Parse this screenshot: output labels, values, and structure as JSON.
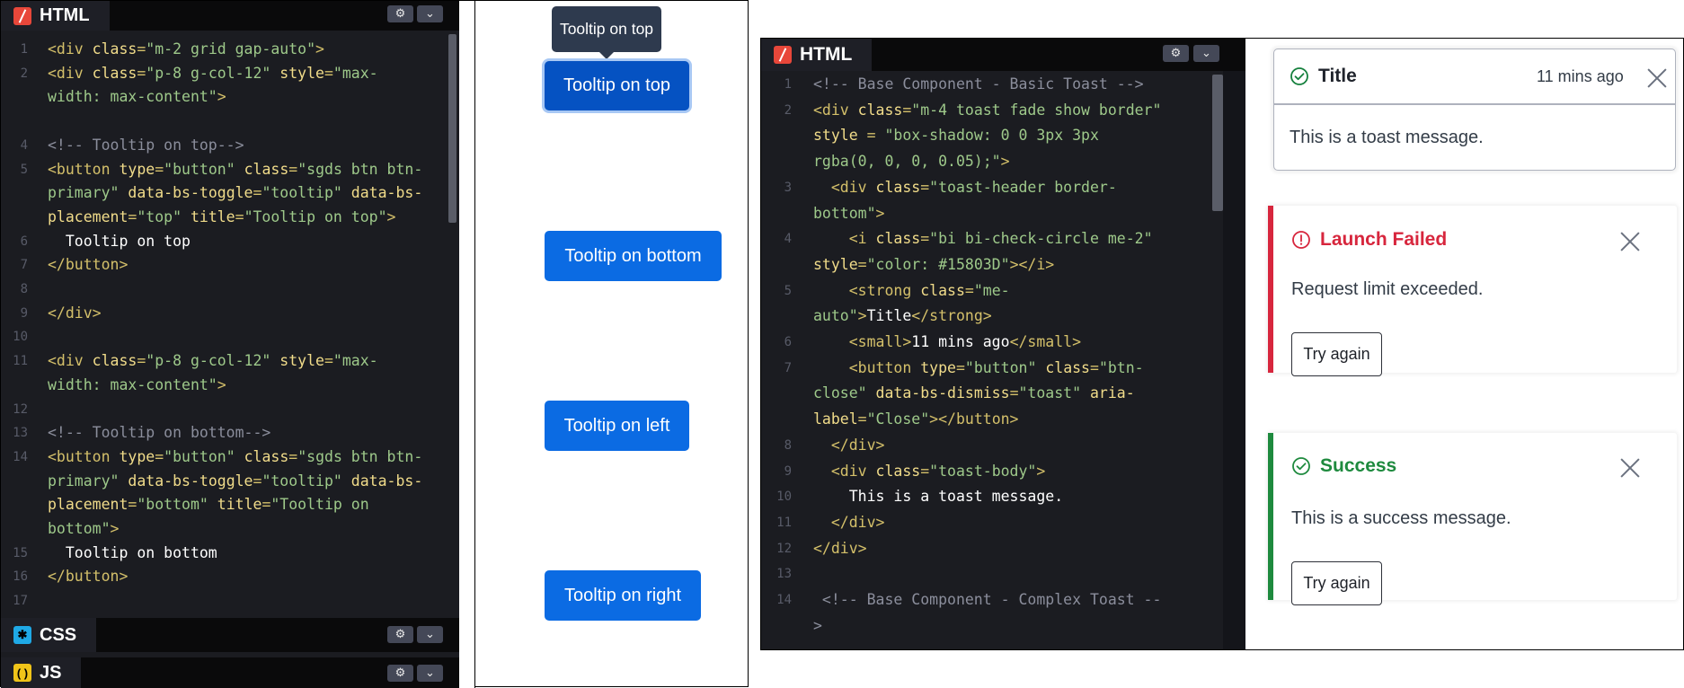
{
  "panel1": {
    "html_tab": "HTML",
    "css_tab": "CSS",
    "js_tab": "JS",
    "line_numbers": [
      "1",
      "2",
      "",
      "",
      "4",
      "5",
      "",
      "",
      "6",
      "7",
      "8",
      "9",
      "10",
      "11",
      "",
      "12",
      "13",
      "14",
      "",
      "",
      "",
      "15",
      "16",
      "17"
    ],
    "code_lines": [
      [
        [
          "tg",
          "<div "
        ],
        [
          "at",
          "class"
        ],
        [
          "tg",
          "="
        ],
        [
          "st",
          "\"m-2 grid gap-auto\""
        ],
        [
          "tg",
          ">"
        ]
      ],
      [
        [
          "tg",
          "<div "
        ],
        [
          "at",
          "class"
        ],
        [
          "tg",
          "="
        ],
        [
          "st",
          "\"p-8 g-col-12\""
        ],
        [
          "at",
          " style"
        ],
        [
          "tg",
          "="
        ],
        [
          "st",
          "\"max-"
        ]
      ],
      [
        [
          "st",
          "width: max-content\""
        ],
        [
          "tg",
          ">"
        ]
      ],
      [],
      [
        [
          "cm",
          "<!-- Tooltip on top-->"
        ]
      ],
      [
        [
          "tg",
          "<button "
        ],
        [
          "at",
          "type"
        ],
        [
          "tg",
          "="
        ],
        [
          "st",
          "\"button\""
        ],
        [
          "at",
          " class"
        ],
        [
          "tg",
          "="
        ],
        [
          "st",
          "\"sgds btn btn-"
        ]
      ],
      [
        [
          "st",
          "primary\""
        ],
        [
          "at",
          " data-bs-toggle"
        ],
        [
          "tg",
          "="
        ],
        [
          "st",
          "\"tooltip\""
        ],
        [
          "at",
          " data-bs-"
        ]
      ],
      [
        [
          "at",
          "placement"
        ],
        [
          "tg",
          "="
        ],
        [
          "st",
          "\"top\""
        ],
        [
          "at",
          " title"
        ],
        [
          "tg",
          "="
        ],
        [
          "st",
          "\"Tooltip on top\""
        ],
        [
          "tg",
          ">"
        ]
      ],
      [
        [
          "tx",
          "  Tooltip on top"
        ]
      ],
      [
        [
          "tg",
          "</button>"
        ]
      ],
      [],
      [
        [
          "tg",
          "</div>"
        ]
      ],
      [],
      [
        [
          "tg",
          "<div "
        ],
        [
          "at",
          "class"
        ],
        [
          "tg",
          "="
        ],
        [
          "st",
          "\"p-8 g-col-12\""
        ],
        [
          "at",
          " style"
        ],
        [
          "tg",
          "="
        ],
        [
          "st",
          "\"max-"
        ]
      ],
      [
        [
          "st",
          "width: max-content\""
        ],
        [
          "tg",
          ">"
        ]
      ],
      [],
      [
        [
          "cm",
          "<!-- Tooltip on bottom-->"
        ]
      ],
      [
        [
          "tg",
          "<button "
        ],
        [
          "at",
          "type"
        ],
        [
          "tg",
          "="
        ],
        [
          "st",
          "\"button\""
        ],
        [
          "at",
          " class"
        ],
        [
          "tg",
          "="
        ],
        [
          "st",
          "\"sgds btn btn-"
        ]
      ],
      [
        [
          "st",
          "primary\""
        ],
        [
          "at",
          " data-bs-toggle"
        ],
        [
          "tg",
          "="
        ],
        [
          "st",
          "\"tooltip\""
        ],
        [
          "at",
          " data-bs-"
        ]
      ],
      [
        [
          "at",
          "placement"
        ],
        [
          "tg",
          "="
        ],
        [
          "st",
          "\"bottom\""
        ],
        [
          "at",
          " title"
        ],
        [
          "tg",
          "="
        ],
        [
          "st",
          "\"Tooltip on"
        ]
      ],
      [
        [
          "st",
          "bottom\""
        ],
        [
          "tg",
          ">"
        ]
      ],
      [
        [
          "tx",
          "  Tooltip on bottom"
        ]
      ],
      [
        [
          "tg",
          "</button>"
        ]
      ],
      []
    ],
    "tooltip_text": "Tooltip on top",
    "buttons": [
      "Tooltip on top",
      "Tooltip on bottom",
      "Tooltip on left",
      "Tooltip on right"
    ]
  },
  "panel2": {
    "html_tab": "HTML",
    "line_numbers": [
      "1",
      "2",
      "",
      "",
      "3",
      "",
      "4",
      "",
      "5",
      "",
      "6",
      "7",
      "",
      "",
      "8",
      "9",
      "10",
      "11",
      "12",
      "13",
      "14",
      ""
    ],
    "code_lines": [
      [
        [
          "cm",
          "<!-- Base Component - Basic Toast -->"
        ]
      ],
      [
        [
          "tg",
          "<div "
        ],
        [
          "at",
          "class"
        ],
        [
          "tg",
          "="
        ],
        [
          "st",
          "\"m-4 toast fade show border\""
        ]
      ],
      [
        [
          "at",
          "style"
        ],
        [
          "tg",
          " = "
        ],
        [
          "st",
          "\"box-shadow: 0 0 3px 3px"
        ]
      ],
      [
        [
          "st",
          "rgba(0, 0, 0, 0.05);\""
        ],
        [
          "tg",
          ">"
        ]
      ],
      [
        [
          "tg",
          "  <div "
        ],
        [
          "at",
          "class"
        ],
        [
          "tg",
          "="
        ],
        [
          "st",
          "\"toast-header border-"
        ]
      ],
      [
        [
          "st",
          "bottom\""
        ],
        [
          "tg",
          ">"
        ]
      ],
      [
        [
          "tg",
          "    <i "
        ],
        [
          "at",
          "class"
        ],
        [
          "tg",
          "="
        ],
        [
          "st",
          "\"bi bi-check-circle me-2\""
        ]
      ],
      [
        [
          "at",
          "style"
        ],
        [
          "tg",
          "="
        ],
        [
          "st",
          "\"color: #15803D\""
        ],
        [
          "tg",
          "></i>"
        ]
      ],
      [
        [
          "tg",
          "    <strong "
        ],
        [
          "at",
          "class"
        ],
        [
          "tg",
          "="
        ],
        [
          "st",
          "\"me-"
        ]
      ],
      [
        [
          "st",
          "auto\""
        ],
        [
          "tg",
          ">"
        ],
        [
          "tx",
          "Title"
        ],
        [
          "tg",
          "</strong>"
        ]
      ],
      [
        [
          "tg",
          "    <small>"
        ],
        [
          "tx",
          "11 mins ago"
        ],
        [
          "tg",
          "</small>"
        ]
      ],
      [
        [
          "tg",
          "    <button "
        ],
        [
          "at",
          "type"
        ],
        [
          "tg",
          "="
        ],
        [
          "st",
          "\"button\""
        ],
        [
          "at",
          " class"
        ],
        [
          "tg",
          "="
        ],
        [
          "st",
          "\"btn-"
        ]
      ],
      [
        [
          "st",
          "close\""
        ],
        [
          "at",
          " data-bs-dismiss"
        ],
        [
          "tg",
          "="
        ],
        [
          "st",
          "\"toast\""
        ],
        [
          "at",
          " aria-"
        ]
      ],
      [
        [
          "at",
          "label"
        ],
        [
          "tg",
          "="
        ],
        [
          "st",
          "\"Close\""
        ],
        [
          "tg",
          "></button>"
        ]
      ],
      [
        [
          "tg",
          "  </div>"
        ]
      ],
      [
        [
          "tg",
          "  <div "
        ],
        [
          "at",
          "class"
        ],
        [
          "tg",
          "="
        ],
        [
          "st",
          "\"toast-body\""
        ],
        [
          "tg",
          ">"
        ]
      ],
      [
        [
          "tx",
          "    This is a toast message."
        ]
      ],
      [
        [
          "tg",
          "  </div>"
        ]
      ],
      [
        [
          "tg",
          "</div>"
        ]
      ],
      [],
      [
        [
          "cm",
          " <!-- Base Component - Complex Toast --"
        ]
      ],
      [
        [
          "cm",
          ">"
        ]
      ]
    ],
    "toast_basic": {
      "title": "Title",
      "time": "11 mins ago",
      "message": "This is a toast message."
    },
    "toast_failed": {
      "title": "Launch Failed",
      "message": "Request limit exceeded.",
      "button": "Try again",
      "color": "#d7263d"
    },
    "toast_success": {
      "title": "Success",
      "message": "This is a success message.",
      "button": "Try again",
      "color": "#1e8a3e"
    },
    "check_color": "#15803D"
  }
}
